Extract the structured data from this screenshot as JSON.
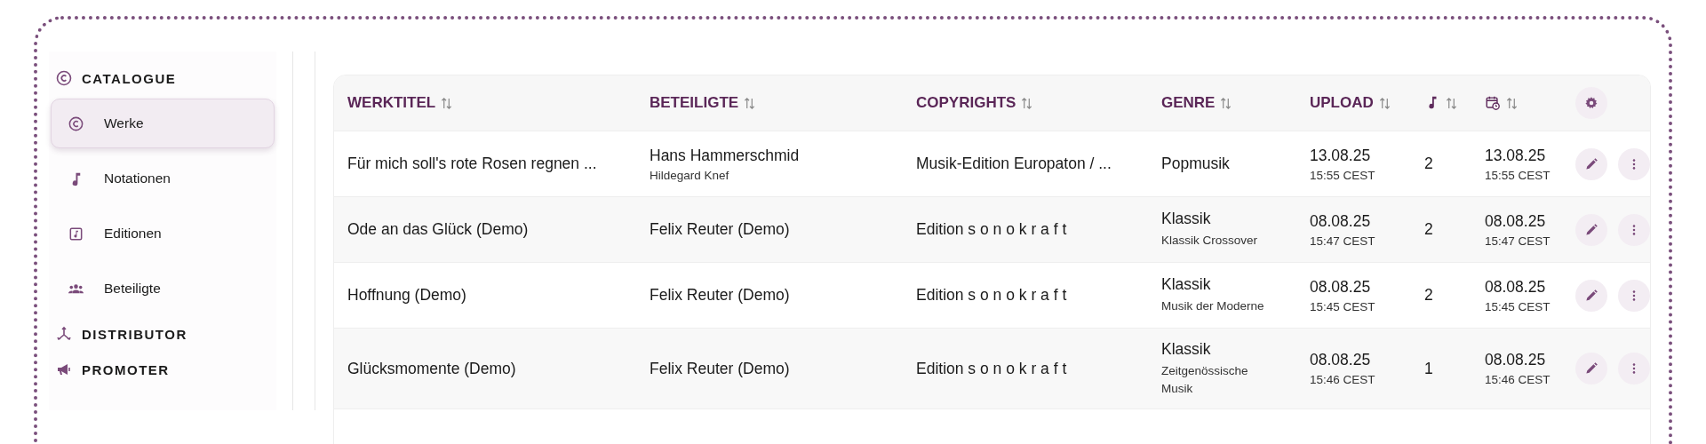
{
  "sidebar": {
    "sections": [
      {
        "label": "CATALOGUE",
        "kind": "copyright",
        "items": [
          {
            "label": "Werke",
            "kind": "copyright",
            "selected": true
          },
          {
            "label": "Notationen",
            "kind": "note",
            "selected": false
          },
          {
            "label": "Editionen",
            "kind": "sheet",
            "selected": false
          },
          {
            "label": "Beteiligte",
            "kind": "people",
            "selected": false
          }
        ]
      },
      {
        "label": "DISTRIBUTOR",
        "kind": "distribute"
      },
      {
        "label": "PROMOTER",
        "kind": "megaphone"
      }
    ]
  },
  "table": {
    "columns": [
      {
        "kind": "text",
        "label": "WERKTITEL",
        "sortable": true
      },
      {
        "kind": "text",
        "label": "BETEILIGTE",
        "sortable": true
      },
      {
        "kind": "text",
        "label": "COPYRIGHTS",
        "sortable": true
      },
      {
        "kind": "text",
        "label": "GENRE",
        "sortable": true
      },
      {
        "kind": "text",
        "label": "UPLOAD",
        "sortable": true
      },
      {
        "kind": "note",
        "sortable": true
      },
      {
        "kind": "calendar",
        "sortable": true
      },
      {
        "kind": "settings",
        "sortable": false
      }
    ],
    "rows": [
      {
        "title": "Für mich soll's rote Rosen regnen ...",
        "participant": "Hans Hammerschmid",
        "participant_sub": "Hildegard Knef",
        "copyright": "Musik-Edition Europaton / ...",
        "genre": "Popmusik",
        "upload_date": "13.08.25",
        "upload_time": "15:55 CEST",
        "count": "2",
        "modified_date": "13.08.25",
        "modified_time": "15:55 CEST"
      },
      {
        "title": "Ode an das Glück (Demo)",
        "participant": "Felix Reuter (Demo)",
        "copyright": "Edition s o n o k r a f t",
        "genre": "Klassik",
        "genre_sub": "Klassik Crossover",
        "upload_date": "08.08.25",
        "upload_time": "15:47 CEST",
        "count": "2",
        "modified_date": "08.08.25",
        "modified_time": "15:47 CEST"
      },
      {
        "title": "Hoffnung (Demo)",
        "participant": "Felix Reuter (Demo)",
        "copyright": "Edition s o n o k r a f t",
        "genre": "Klassik",
        "genre_sub": "Musik der Moderne",
        "upload_date": "08.08.25",
        "upload_time": "15:45 CEST",
        "count": "2",
        "modified_date": "08.08.25",
        "modified_time": "15:45 CEST"
      },
      {
        "title": "Glücksmomente (Demo)",
        "participant": "Felix Reuter (Demo)",
        "copyright": "Edition s o n o k r a f t",
        "genre": "Klassik",
        "genre_sub": "Zeitgenössische Musik",
        "upload_date": "08.08.25",
        "upload_time": "15:46 CEST",
        "count": "1",
        "modified_date": "08.08.25",
        "modified_time": "15:46 CEST"
      }
    ]
  }
}
